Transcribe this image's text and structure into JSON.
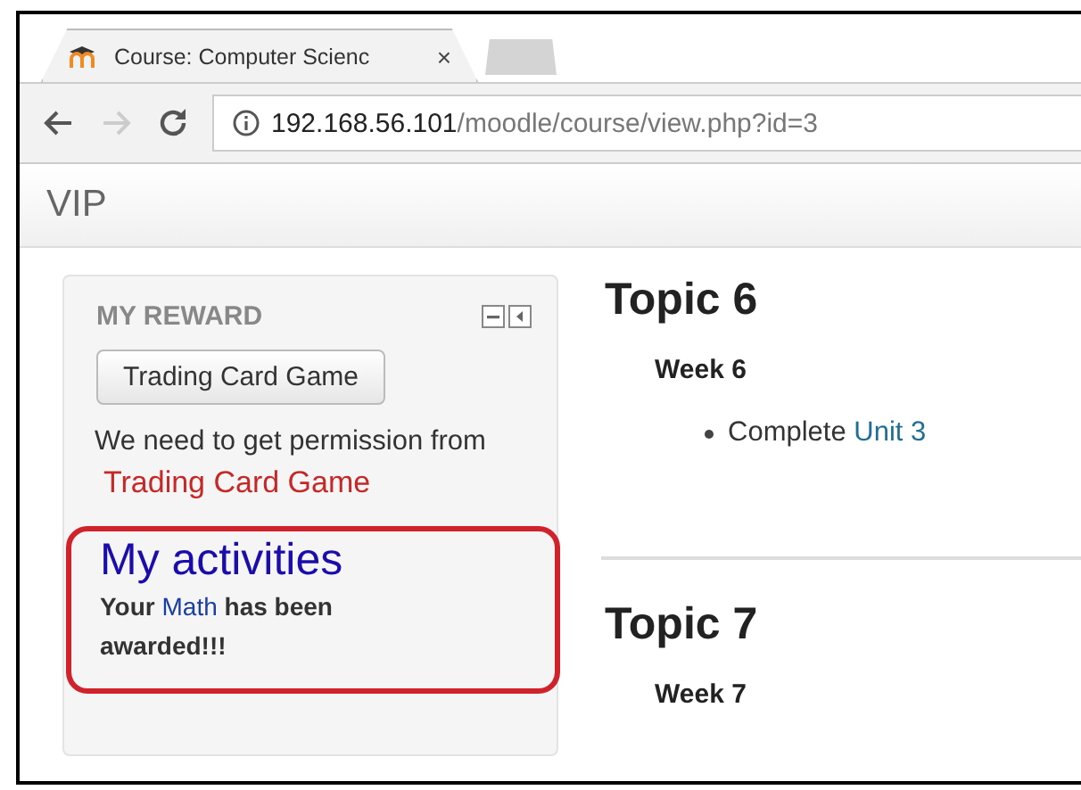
{
  "browser": {
    "tabs": [
      {
        "title": "Course: Computer Scienc",
        "selected": true,
        "close": "×"
      },
      {
        "selected": false
      }
    ],
    "address": {
      "host": "192.168.56.101",
      "path": "/moodle/course/view.php?id=3"
    },
    "nav": {
      "back_enabled": true,
      "forward_enabled": false
    }
  },
  "navbar": {
    "brand": "VIP"
  },
  "block": {
    "title": "MY REWARD",
    "button": "Trading Card Game",
    "message": "We need to get permission from",
    "link": "Trading Card Game",
    "activities": {
      "title": "My activities",
      "before": "Your",
      "link": "Math",
      "after": "has been awarded!!!",
      "highlighted": true
    }
  },
  "topics": [
    {
      "title": "Topic 6",
      "week": "Week 6",
      "items": [
        {
          "text": "Complete",
          "link": "Unit 3"
        }
      ]
    },
    {
      "title": "Topic 7",
      "week": "Week 7"
    }
  ]
}
